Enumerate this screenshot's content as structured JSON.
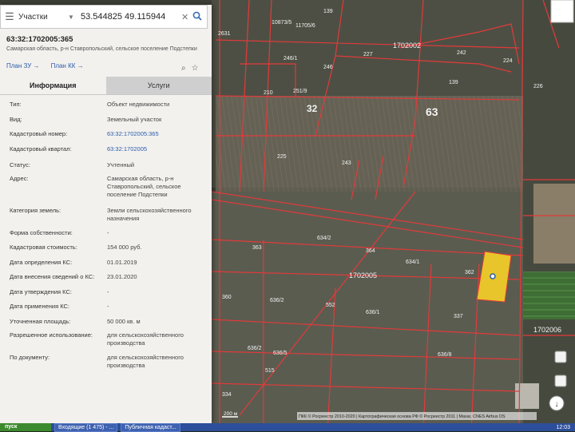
{
  "search": {
    "layer": "Участки",
    "coords": "53.544825 49.115944"
  },
  "parcel": {
    "cadnum": "63:32:1702005:365",
    "address_head": "Самарская область, р-н Ставропольский, сельское поселение Подстепки",
    "plan_zu": "План ЗУ →",
    "plan_kk": "План КК →"
  },
  "tabs": {
    "info": "Информация",
    "services": "Услуги"
  },
  "fields": [
    {
      "label": "Тип:",
      "value": "Объект недвижимости"
    },
    {
      "label": "Вид:",
      "value": "Земельный участок"
    },
    {
      "label": "Кадастровый номер:",
      "value": "63:32:1702005:365"
    },
    {
      "label": "Кадастровый квартал:",
      "value": "63:32:1702005"
    },
    {
      "label": "Статус:",
      "value": "Учтенный"
    },
    {
      "label": "Адрес:",
      "value": "Самарская область, р-н Ставропольский, сельское поселение Подстепки"
    },
    {
      "label": "Категория земель:",
      "value": "Земли сельскохозяйственного назначения"
    },
    {
      "label": "Форма собственности:",
      "value": "-"
    },
    {
      "label": "Кадастровая стоимость:",
      "value": "154 000 руб."
    },
    {
      "label": "Дата определения КС:",
      "value": "01.01.2019"
    },
    {
      "label": "Дата внесения сведений о КС:",
      "value": "23.01.2020"
    },
    {
      "label": "Дата утверждения КС:",
      "value": "-"
    },
    {
      "label": "Дата применения КС:",
      "value": "-"
    },
    {
      "label": "Уточненная площадь:",
      "value": "50 000 кв. м"
    },
    {
      "label": "Разрешенное использование:",
      "value": "для сельскохозяйственного производства"
    },
    {
      "label": "По документу:",
      "value": "для сельскохозяйственного производства"
    }
  ],
  "map": {
    "labels": {
      "l2631": "2631",
      "l10873": "10873/5",
      "l11705": "11705/6",
      "l139a": "139",
      "l1702002": "1702002",
      "l242": "242",
      "l224": "224",
      "l227": "227",
      "l2461": "246/1",
      "l246": "246",
      "l210": "210",
      "l2519": "251/9",
      "l32": "32",
      "l63": "63",
      "l225": "225",
      "l243": "243",
      "l139b": "139",
      "l226": "226",
      "l6342": "634/2",
      "l363": "363",
      "l364": "364",
      "l6341": "634/1",
      "l1702005": "1702005",
      "l636": "636/2",
      "l362": "362",
      "l360": "360",
      "l552": "552",
      "l6361": "636/1",
      "l337": "337",
      "l1702006": "1702006",
      "l6362": "636/2",
      "l6365": "636/5",
      "l6368": "636/8",
      "l515": "515",
      "l334": "334"
    },
    "scale": "200 м",
    "attribution": "ПКК © Росреестр 2010-2020 | Картографическая основа РФ © Росреестр 2011 | Maxar, CNES Airbus DS"
  },
  "taskbar": {
    "start": "пуск",
    "items": [
      "Входящие (1 475) - ...",
      "Публичная кадаст..."
    ],
    "time": "12:03"
  },
  "colors": {
    "boundary": "#e23a3a",
    "highlight": "#e8c52a",
    "panel_bg": "#f3f1ee",
    "link": "#2a5caa"
  }
}
